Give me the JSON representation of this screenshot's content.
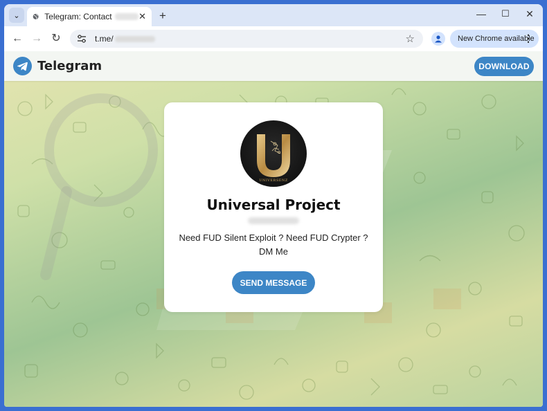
{
  "browser": {
    "tab_title": "Telegram: Contact",
    "url": "t.me/",
    "new_chrome_label": "New Chrome available"
  },
  "telegram": {
    "brand": "Telegram",
    "download_label": "DOWNLOAD"
  },
  "channel": {
    "avatar_text": "UNIVERSENZ",
    "name": "Universal Project",
    "description": "Need FUD Silent Exploit ? Need FUD Crypter ? DM Me",
    "send_label": "SEND MESSAGE"
  },
  "colors": {
    "accent": "#3d86c6",
    "gold": "#c9a560"
  }
}
